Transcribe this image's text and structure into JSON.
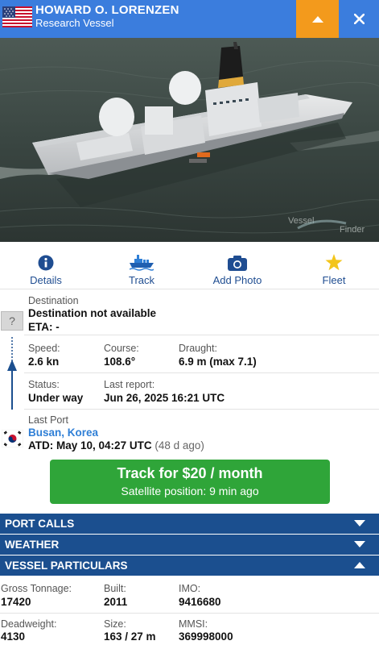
{
  "header": {
    "vessel_name": "HOWARD O. LORENZEN",
    "vessel_type": "Research Vessel",
    "flag_icon": "us-flag-icon",
    "up_icon": "caret-up-icon",
    "close_icon": "close-icon",
    "bg_color": "#3b7ddd",
    "accent_color": "#f39a1c"
  },
  "photo": {
    "watermark_line1": "Vessel",
    "watermark_line2": "Finder"
  },
  "actions": [
    {
      "label": "Details",
      "icon": "info-icon"
    },
    {
      "label": "Track",
      "icon": "ship-icon"
    },
    {
      "label": "Add Photo",
      "icon": "camera-icon"
    },
    {
      "label": "Fleet",
      "icon": "star-icon"
    }
  ],
  "destination": {
    "label": "Destination",
    "value": "Destination not available",
    "eta_label": "ETA:",
    "eta_value": "-",
    "unknown_icon": "?"
  },
  "voyage": {
    "speed_label": "Speed:",
    "speed_value": "2.6 kn",
    "course_label": "Course:",
    "course_value": "108.6°",
    "draught_label": "Draught:",
    "draught_value": "6.9 m (max 7.1)",
    "status_label": "Status:",
    "status_value": "Under way",
    "report_label": "Last report:",
    "report_value": "Jun 26, 2025 16:21 UTC"
  },
  "last_port": {
    "label": "Last Port",
    "port_name": "Busan, Korea",
    "atd_label": "ATD:",
    "atd_value": "May 10, 04:27 UTC",
    "atd_ago": "(48 d ago)",
    "flag_icon": "south-korea-flag-icon"
  },
  "track_button": {
    "title": "Track for $20 / month",
    "subtitle": "Satellite position: 9 min ago",
    "color": "#2fa539"
  },
  "sections": [
    {
      "title": "PORT CALLS",
      "state": "collapsed"
    },
    {
      "title": "WEATHER",
      "state": "collapsed"
    },
    {
      "title": "VESSEL PARTICULARS",
      "state": "expanded"
    }
  ],
  "particulars": {
    "gross_label": "Gross Tonnage:",
    "gross_value": "17420",
    "built_label": "Built:",
    "built_value": "2011",
    "imo_label": "IMO:",
    "imo_value": "9416680",
    "deadweight_label": "Deadweight:",
    "deadweight_value": "4130",
    "size_label": "Size:",
    "size_value": "163 / 27 m",
    "mmsi_label": "MMSI:",
    "mmsi_value": "369998000"
  }
}
